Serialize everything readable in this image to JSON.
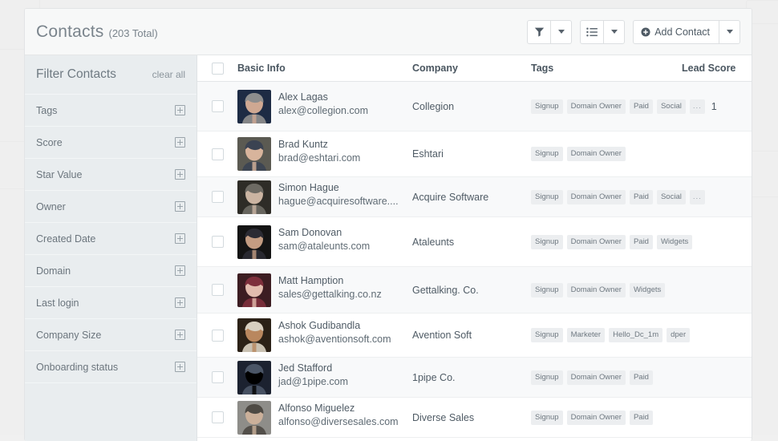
{
  "header": {
    "title": "Contacts",
    "count_label": "(203 Total)"
  },
  "toolbar": {
    "filter_icon": "funnel-icon",
    "filter_caret": "chevron-down-icon",
    "list_icon": "list-view-icon",
    "list_caret": "chevron-down-icon",
    "add_label": "Add Contact",
    "add_icon": "plus-circle-icon",
    "add_caret": "chevron-down-icon"
  },
  "sidebar": {
    "title": "Filter Contacts",
    "clear_label": "clear all",
    "items": [
      {
        "label": "Tags"
      },
      {
        "label": "Score"
      },
      {
        "label": "Star Value"
      },
      {
        "label": "Owner"
      },
      {
        "label": "Created Date"
      },
      {
        "label": "Domain"
      },
      {
        "label": "Last login"
      },
      {
        "label": "Company Size"
      },
      {
        "label": "Onboarding status"
      }
    ]
  },
  "table": {
    "columns": {
      "basic": "Basic Info",
      "company": "Company",
      "tags": "Tags",
      "score": "Lead Score"
    },
    "rows": [
      {
        "name": "Alex Lagas",
        "email": "alex@collegion.com",
        "company": "Collegion",
        "tags": [
          "Signup",
          "Domain Owner",
          "Paid",
          "Social",
          "..."
        ],
        "score": "1",
        "avatar": "woman-gray-hair-photo"
      },
      {
        "name": "Brad Kuntz",
        "email": "brad@eshtari.com",
        "company": "Eshtari",
        "tags": [
          "Signup",
          "Domain Owner"
        ],
        "score": "",
        "avatar": "man-suit-photo"
      },
      {
        "name": "Simon Hague",
        "email": "hague@acquiresoftware....",
        "company": "Acquire Software",
        "tags": [
          "Signup",
          "Domain Owner",
          "Paid",
          "Social",
          "..."
        ],
        "score": "",
        "avatar": "older-man-photo"
      },
      {
        "name": "Sam Donovan",
        "email": "sam@ataleunts.com",
        "company": "Ataleunts",
        "tags": [
          "Signup",
          "Domain Owner",
          "Paid",
          "Widgets"
        ],
        "score": "",
        "avatar": "man-dark-suit-photo"
      },
      {
        "name": "Matt Hamption",
        "email": "sales@gettalking.co.nz",
        "company": "Gettalking. Co.",
        "tags": [
          "Signup",
          "Domain Owner",
          "Widgets"
        ],
        "score": "",
        "avatar": "woman-red-hair-photo"
      },
      {
        "name": "Ashok Gudibandla",
        "email": "ashok@aventionsoft.com",
        "company": "Avention Soft",
        "tags": [
          "Signup",
          "Marketer",
          "Hello_Dc_1m",
          "dper"
        ],
        "score": "",
        "avatar": "man-smiling-photo"
      },
      {
        "name": "Jed Stafford",
        "email": "jad@1pipe.com",
        "company": "1pipe Co.",
        "tags": [
          "Signup",
          "Domain Owner",
          "Paid"
        ],
        "score": "",
        "avatar": "man-office-photo"
      },
      {
        "name": "Alfonso Miguelez",
        "email": "alfonso@diversesales.com",
        "company": "Diverse Sales",
        "tags": [
          "Signup",
          "Domain Owner",
          "Paid"
        ],
        "score": "",
        "avatar": "man-beard-photo"
      }
    ]
  }
}
